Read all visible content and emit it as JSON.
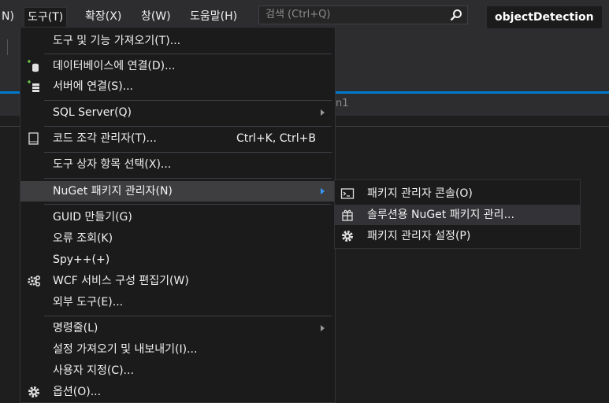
{
  "menubar": {
    "partial": "N)",
    "items": [
      "도구(T)",
      "확장(X)",
      "창(W)",
      "도움말(H)"
    ],
    "search_placeholder": "검색 (Ctrl+Q)",
    "project": "objectDetection"
  },
  "tab_fragment": "n1",
  "dropdown": {
    "items": [
      {
        "label": "도구 및 기능 가져오기(T)..."
      },
      {
        "label": "데이터베이스에 연결(D)...",
        "icon": "database-connect-icon"
      },
      {
        "label": "서버에 연결(S)...",
        "icon": "server-connect-icon"
      },
      {
        "label": "SQL Server(Q)",
        "submenu": true
      },
      {
        "label": "코드 조각 관리자(T)...",
        "shortcut": "Ctrl+K, Ctrl+B",
        "icon": "code-snippet-icon"
      },
      {
        "label": "도구 상자 항목 선택(X)..."
      },
      {
        "label": "NuGet 패키지 관리자(N)",
        "submenu": true,
        "highlighted": true
      },
      {
        "label": "GUID 만들기(G)"
      },
      {
        "label": "오류 조회(K)"
      },
      {
        "label": "Spy++(+)"
      },
      {
        "label": "WCF 서비스 구성 편집기(W)",
        "icon": "wcf-gear-icon"
      },
      {
        "label": "외부 도구(E)..."
      },
      {
        "label": "명령줄(L)",
        "submenu": true
      },
      {
        "label": "설정 가져오기 및 내보내기(I)..."
      },
      {
        "label": "사용자 지정(C)..."
      },
      {
        "label": "옵션(O)...",
        "icon": "gear-icon"
      }
    ]
  },
  "submenu": {
    "items": [
      {
        "label": "패키지 관리자 콘솔(O)",
        "icon": "console-icon"
      },
      {
        "label": "솔루션용 NuGet 패키지 관리...",
        "icon": "package-icon",
        "highlighted": true
      },
      {
        "label": "패키지 관리자 설정(P)",
        "icon": "gear-icon"
      }
    ]
  },
  "colors": {
    "menu_bg": "#1b1b1c",
    "highlight": "#3e3e40",
    "accent_blue": "#007acc",
    "submenu_arrow_active": "#3399ff"
  }
}
